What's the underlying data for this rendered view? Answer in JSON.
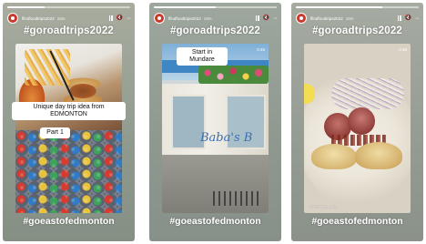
{
  "stories": [
    {
      "progress": 0.3,
      "username": "ffindfoodtrips2022",
      "time": "19m",
      "hashtag_top": "#goroadtrips2022",
      "hashtag_bottom": "#goeastofedmonton",
      "bubbles": [
        "Unique day trip idea from EDMONTON",
        "Part 1"
      ]
    },
    {
      "progress": 0.5,
      "username": "ffindfoodtrips2022",
      "time": "19m",
      "hashtag_top": "#goroadtrips2022",
      "hashtag_bottom": "#goeastofedmonton",
      "bubbles": [
        "Start in Mundare"
      ],
      "sign_text": "Baba's B",
      "photo_time": "0:45"
    },
    {
      "progress": 0.7,
      "username": "ffindfoodtrips2022",
      "time": "19m",
      "hashtag_top": "#goroadtrips2022",
      "hashtag_bottom": "#goeastofedmonton",
      "photo_time": "0:36",
      "credit": "@mundare_cafe"
    }
  ],
  "icons": {
    "avatar": "avatar-icon",
    "pause": "pause-icon",
    "mute": "speaker-icon",
    "more": "more-dots-icon"
  },
  "colors": {
    "hashtag": "#ffffff",
    "avatar": "#c93a2c"
  }
}
